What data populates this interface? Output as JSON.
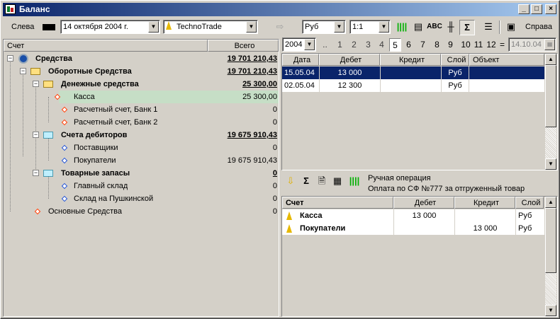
{
  "window": {
    "title": "Баланс",
    "minimize_label": "_",
    "maximize_label": "□",
    "close_label": "×"
  },
  "toolbar": {
    "left_label": "Слева",
    "date_value": "14 октября  2004 г.",
    "company_value": "TechnoTrade",
    "currency_value": "Руб",
    "scale_value": "1:1",
    "right_label": "Справа"
  },
  "tree": {
    "header_account": "Счет",
    "header_total": "Всего",
    "rows": [
      {
        "label": "Средства",
        "total": "19 701 210,43"
      },
      {
        "label": "Оборотные Средства",
        "total": "19 701 210,43"
      },
      {
        "label": "Денежные средства",
        "total": "25 300,00"
      },
      {
        "label": "Касса",
        "total": "25 300,00"
      },
      {
        "label": "Расчетный счет, Банк 1",
        "total": "0"
      },
      {
        "label": "Расчетный счет, Банк 2",
        "total": "0"
      },
      {
        "label": "Счета дебиторов",
        "total": "19 675 910,43"
      },
      {
        "label": "Поставщики",
        "total": "0"
      },
      {
        "label": "Покупатели",
        "total": "19 675 910,43"
      },
      {
        "label": "Товарные запасы",
        "total": "0"
      },
      {
        "label": "Главный склад",
        "total": "0"
      },
      {
        "label": "Склад на Пушкинской",
        "total": "0"
      },
      {
        "label": "Основные Средства",
        "total": "0"
      }
    ]
  },
  "period": {
    "year": "2004",
    "dots": "..",
    "months": [
      "1",
      "2",
      "3",
      "4",
      "5",
      "6",
      "7",
      "8",
      "9",
      "10",
      "11",
      "12"
    ],
    "selected_month": "5",
    "eq": "=",
    "date_field": "14.10.04"
  },
  "transactions": {
    "columns": [
      "Дата",
      "Дебет",
      "Кредит",
      "Слой",
      "Объект"
    ],
    "rows": [
      {
        "date": "15.05.04",
        "debit": "13 000",
        "credit": "",
        "layer": "Руб",
        "object": ""
      },
      {
        "date": "02.05.04",
        "debit": "12 300",
        "credit": "",
        "layer": "Руб",
        "object": ""
      }
    ]
  },
  "operation": {
    "type": "Ручная операция",
    "description": "Оплата по СФ №777 за отгруженный товар"
  },
  "entries": {
    "columns": [
      "Счет",
      "Дебет",
      "Кредит",
      "Слой"
    ],
    "rows": [
      {
        "account": "Касса",
        "debit": "13 000",
        "credit": "",
        "layer": "Руб"
      },
      {
        "account": "Покупатели",
        "debit": "",
        "credit": "13 000",
        "layer": "Руб"
      }
    ]
  },
  "colors": {
    "selection": "#0a246a",
    "highlight_row": "#c6dec6",
    "title_start": "#0a246a",
    "title_end": "#a6caf0"
  }
}
